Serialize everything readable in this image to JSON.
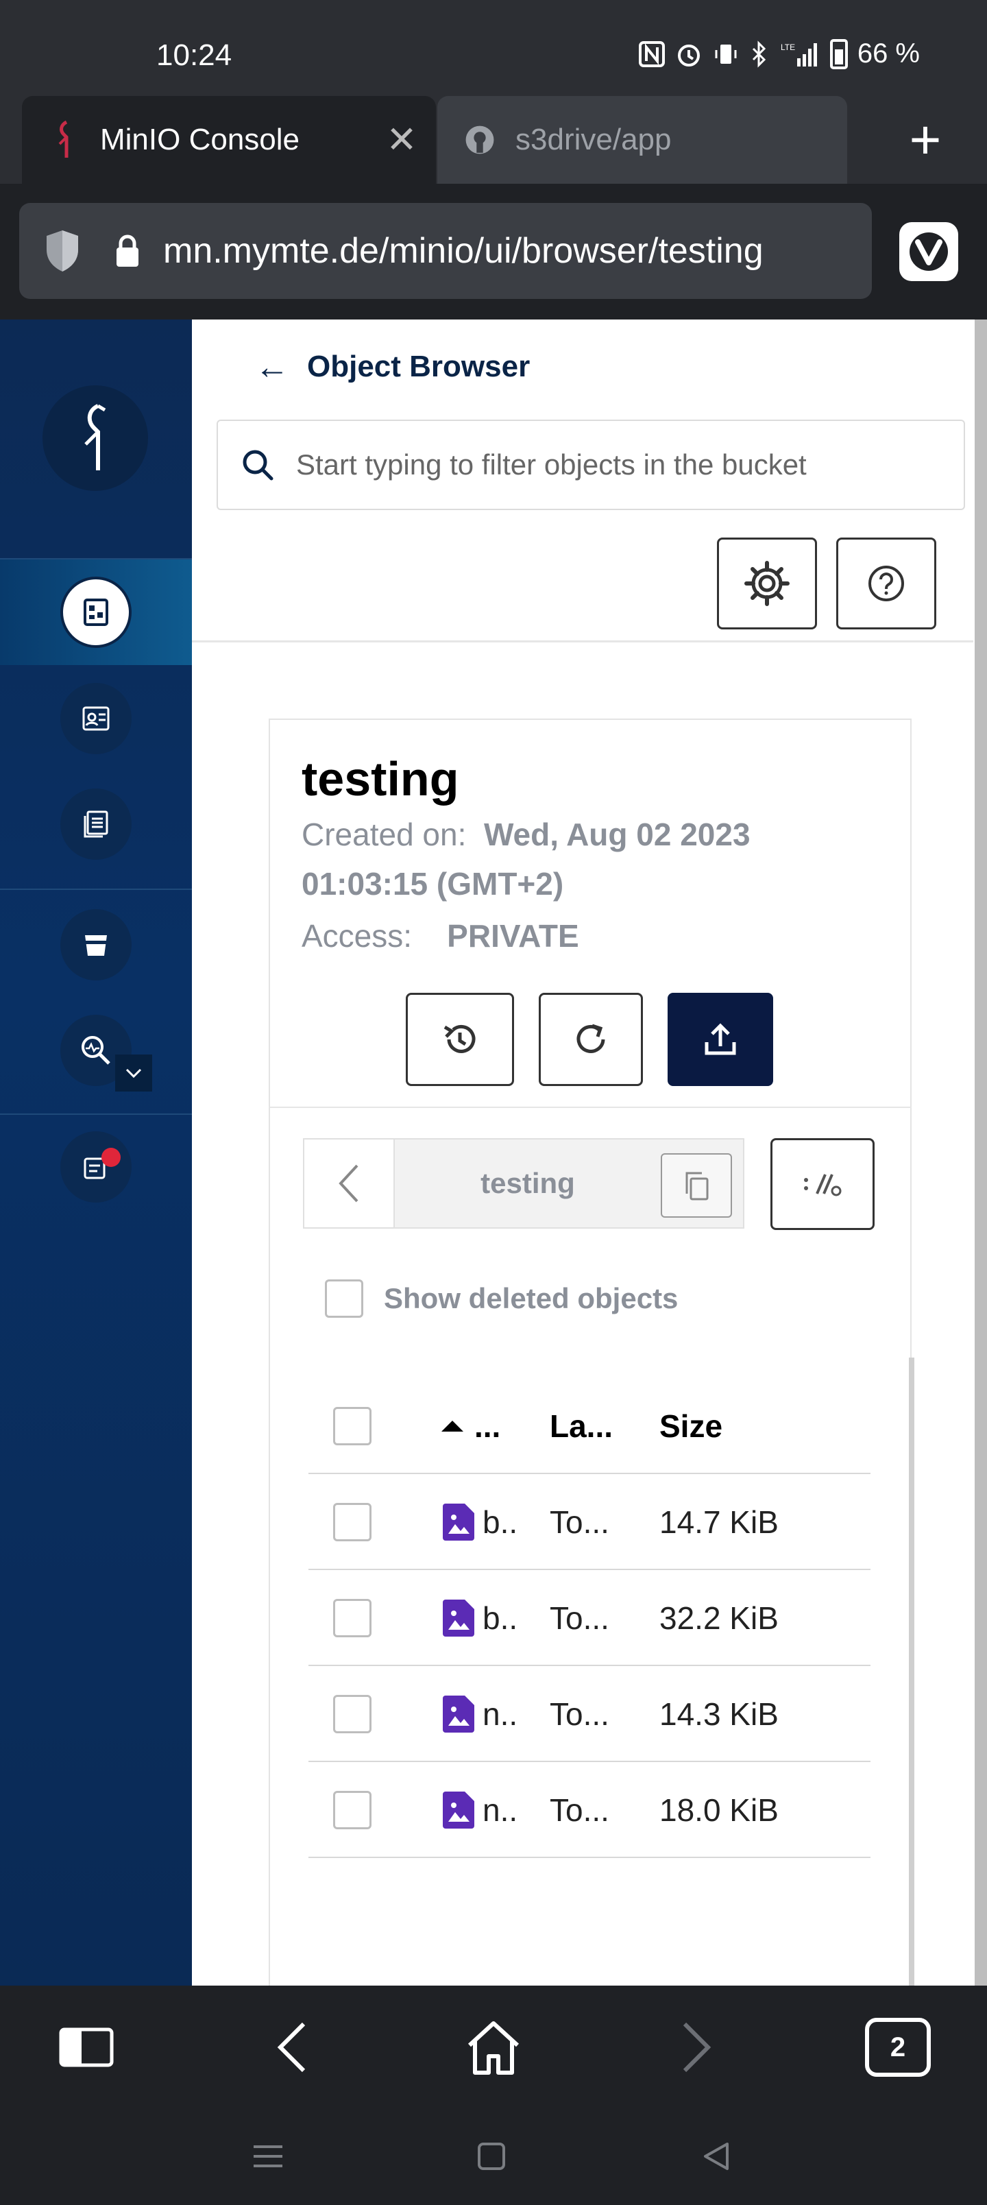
{
  "status_bar": {
    "time": "10:24",
    "battery": "66 %",
    "network": "LTE"
  },
  "tabs": [
    {
      "title": "MinIO Console",
      "active": true
    },
    {
      "title": "s3drive/app",
      "active": false
    }
  ],
  "address_bar": {
    "url": "mn.mymte.de/minio/ui/browser/testing"
  },
  "header": {
    "back_label": "Object Browser"
  },
  "search": {
    "placeholder": "Start typing to filter objects in the bucket",
    "value": ""
  },
  "bucket": {
    "name": "testing",
    "created_label": "Created on:",
    "created_value": "Wed, Aug 02 2023 01:03:15 (GMT+2)",
    "created_line1": "Wed, Aug 02 2023",
    "created_line2": "01:03:15 (GMT+2)",
    "access_label": "Access:",
    "access_value": "PRIVATE"
  },
  "breadcrumb": {
    "current": "testing"
  },
  "show_deleted": {
    "label": "Show deleted objects",
    "checked": false
  },
  "table": {
    "columns": [
      "...",
      "La...",
      "Size"
    ],
    "rows": [
      {
        "name": "b..",
        "last_modified": "To...",
        "size": "14.7 KiB"
      },
      {
        "name": "b..",
        "last_modified": "To...",
        "size": "32.2 KiB"
      },
      {
        "name": "n..",
        "last_modified": "To...",
        "size": "14.3 KiB"
      },
      {
        "name": "n..",
        "last_modified": "To...",
        "size": "18.0 KiB"
      }
    ]
  },
  "browser_nav": {
    "tab_count": "2"
  },
  "colors": {
    "accent": "#0a1a42",
    "sidebar": "#0a2a55",
    "file_icon": "#5b2bb5",
    "notification": "#e0263a"
  }
}
